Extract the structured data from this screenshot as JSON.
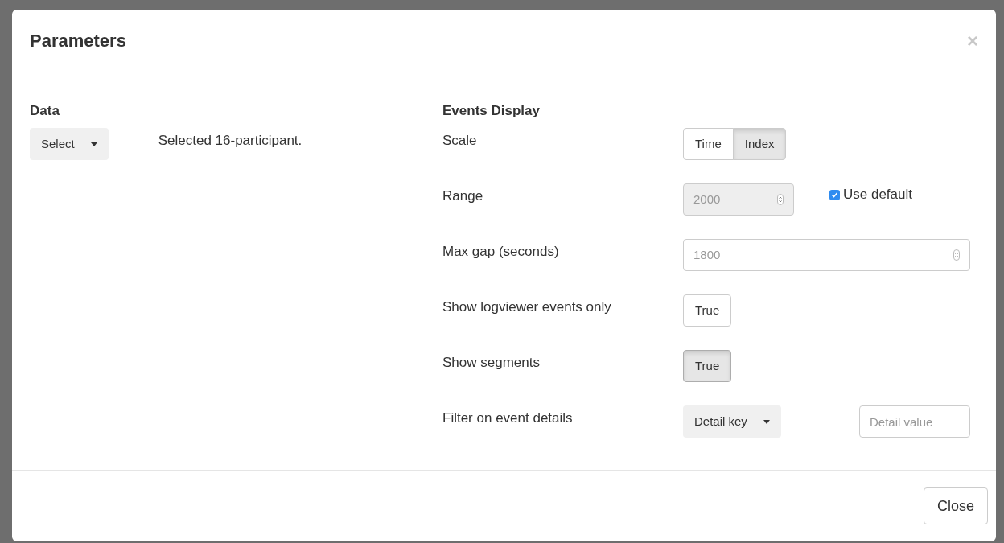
{
  "dialog": {
    "title": "Parameters",
    "close": "×"
  },
  "data_section": {
    "heading": "Data",
    "dropdown": "Select",
    "status": "Selected 16-participant."
  },
  "events_section": {
    "heading": "Events Display",
    "rows": [
      {
        "kind": "segmented",
        "label": "Scale",
        "options": [
          {
            "label": "Time",
            "selected": false
          },
          {
            "label": "Index",
            "selected": true
          }
        ]
      },
      {
        "kind": "number",
        "label": "Range",
        "value": "2000",
        "disabled": true,
        "checkbox": {
          "label": "Use default",
          "checked": true
        }
      },
      {
        "kind": "number",
        "label": "Max gap (seconds)",
        "value": "1800",
        "disabled": false
      },
      {
        "kind": "toggle",
        "label": "Show logviewer events only",
        "text": "True",
        "on": false
      },
      {
        "kind": "toggle",
        "label": "Show segments",
        "text": "True",
        "on": true
      },
      {
        "kind": "filter",
        "label": "Filter on event details",
        "dropdown": "Detail key",
        "placeholder": "Detail value"
      }
    ]
  },
  "footer": {
    "button": "Close"
  }
}
